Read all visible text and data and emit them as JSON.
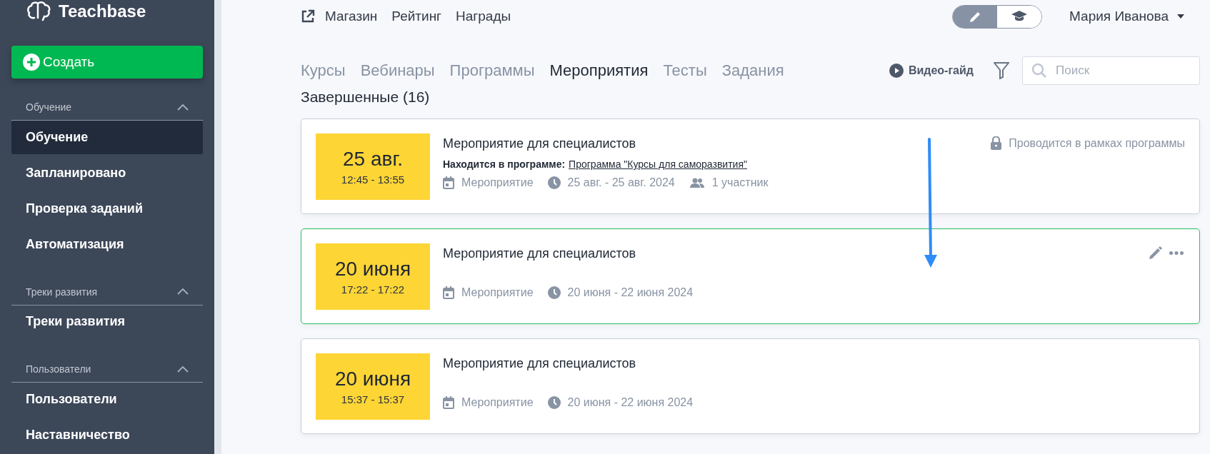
{
  "sidebar": {
    "logo": "Teachbase",
    "create_button": "Создать",
    "sections": [
      {
        "title": "Обучение",
        "expanded": true,
        "items": [
          {
            "label": "Обучение",
            "selected": true
          },
          {
            "label": "Запланировано",
            "selected": false
          },
          {
            "label": "Проверка заданий",
            "selected": false
          },
          {
            "label": "Автоматизация",
            "selected": false
          }
        ]
      },
      {
        "title": "Треки развития",
        "expanded": true,
        "items": [
          {
            "label": "Треки развития",
            "selected": false
          }
        ]
      },
      {
        "title": "Пользователи",
        "expanded": true,
        "items": [
          {
            "label": "Пользователи",
            "selected": false
          },
          {
            "label": "Наставничество",
            "selected": false
          }
        ]
      }
    ]
  },
  "top_links": [
    "Магазин",
    "Рейтинг",
    "Награды"
  ],
  "mode_toggle": [
    {
      "kind": "edit",
      "selected": true
    },
    {
      "kind": "learn",
      "selected": false
    }
  ],
  "user_name": "Мария Иванова",
  "tabs": [
    {
      "label": "Курсы",
      "selected": false
    },
    {
      "label": "Вебинары",
      "selected": false
    },
    {
      "label": "Программы",
      "selected": false
    },
    {
      "label": "Мероприятия",
      "selected": true
    },
    {
      "label": "Тесты",
      "selected": false
    },
    {
      "label": "Задания",
      "selected": false
    }
  ],
  "video_guide": "Видео-гайд",
  "search": {
    "placeholder": "Поиск"
  },
  "section_title": "Завершенные (16)",
  "events": [
    {
      "day": "25 авг.",
      "time": "12:45 - 13:55",
      "title": "Мероприятие для специалистов",
      "selected": false,
      "program_label": "Находится в программе:",
      "program_link": "Программа \"Курсы для саморазвития\"",
      "note": "Проводится в рамках программы",
      "meta": [
        {
          "kind": "type",
          "text": "Мероприятие"
        },
        {
          "kind": "dates",
          "text": "25 авг. - 25 авг. 2024"
        },
        {
          "kind": "participants",
          "text": "1 участник"
        }
      ]
    },
    {
      "day": "20 июня",
      "time": "17:22 - 17:22",
      "title": "Мероприятие для специалистов",
      "selected": true,
      "meta": [
        {
          "kind": "type",
          "text": "Мероприятие"
        },
        {
          "kind": "dates",
          "text": "20 июня - 22 июня 2024"
        }
      ]
    },
    {
      "day": "20 июня",
      "time": "15:37 - 15:37",
      "title": "Мероприятие для специалистов",
      "selected": false,
      "meta": [
        {
          "kind": "type",
          "text": "Мероприятие"
        },
        {
          "kind": "dates",
          "text": "20 июня - 22 июня 2024"
        }
      ]
    }
  ]
}
